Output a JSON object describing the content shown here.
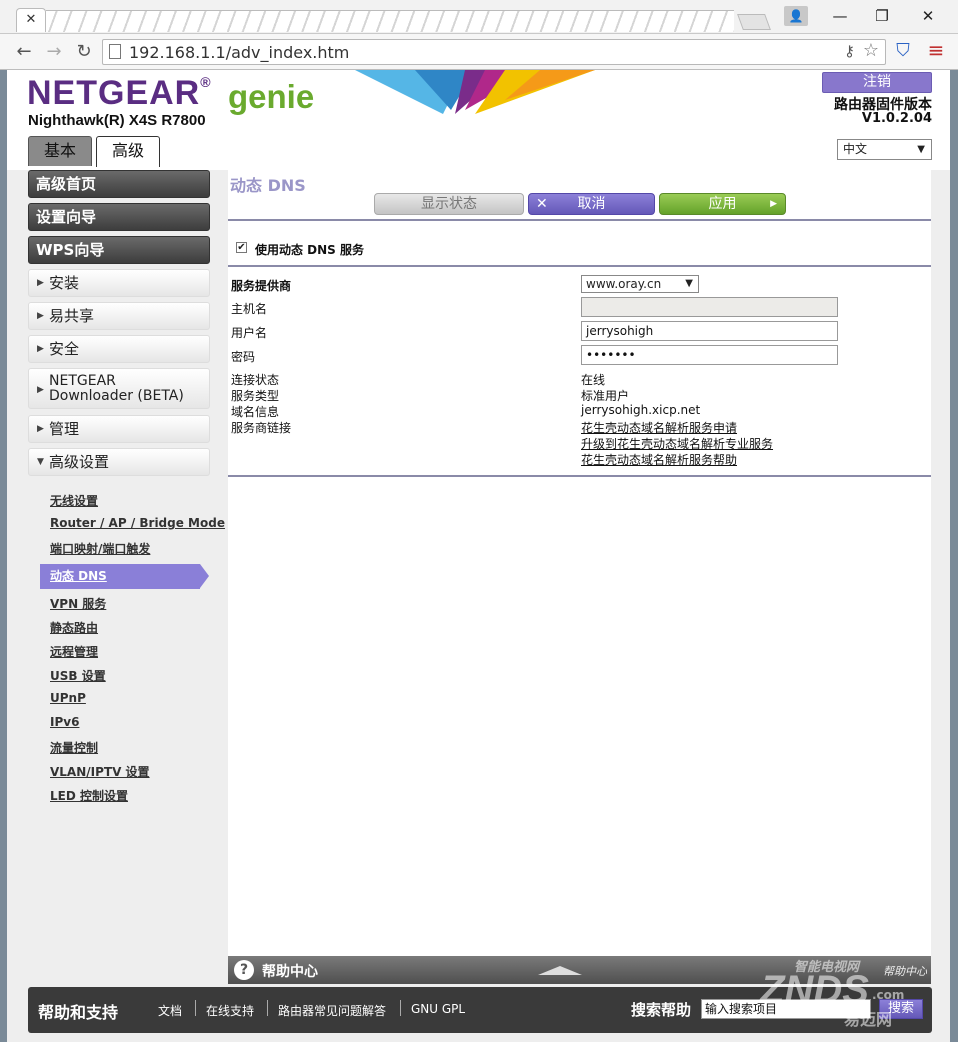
{
  "browser": {
    "url": "192.168.1.1/adv_index.htm",
    "close_tab_label": "✕",
    "window_controls": [
      "—",
      "❐",
      "✕"
    ],
    "nav_icons": [
      "back-icon",
      "forward-icon",
      "reload-icon"
    ]
  },
  "header": {
    "brand": "NETGEAR",
    "brand_mark": "®",
    "product": "genie",
    "model": "Nighthawk(R) X4S R7800",
    "logout": "注销",
    "firmware_label": "路由器固件版本",
    "firmware_version": "V1.0.2.04",
    "tabs": [
      "基本",
      "高级"
    ],
    "language": "中文",
    "colors": {
      "brand": "#5a2d82",
      "genie": "#6aaa2e",
      "accent": "#8a7fd8"
    }
  },
  "sidebar": {
    "dark_items": [
      "高级首页",
      "设置向导",
      "WPS向导"
    ],
    "items": [
      {
        "label": "安装",
        "state": "collapsed"
      },
      {
        "label": "易共享",
        "state": "collapsed"
      },
      {
        "label": "安全",
        "state": "collapsed"
      },
      {
        "label": "NETGEAR",
        "label2": "Downloader (BETA)",
        "state": "collapsed"
      },
      {
        "label": "管理",
        "state": "collapsed"
      },
      {
        "label": "高级设置",
        "state": "expanded"
      }
    ],
    "sub_items": [
      "无线设置",
      "Router / AP / Bridge Mode",
      "端口映射/端口触发",
      "动态 DNS",
      "VPN 服务",
      "静态路由",
      "远程管理",
      "USB 设置",
      "UPnP",
      "IPv6",
      "流量控制",
      "VLAN/IPTV 设置",
      "LED 控制设置"
    ],
    "active_sub": "动态 DNS"
  },
  "main": {
    "title": "动态 DNS",
    "buttons": {
      "status": "显示状态",
      "cancel": "取消",
      "apply": "应用"
    },
    "use_ddns": {
      "label": "使用动态 DNS 服务",
      "checked": true,
      "check_glyph": "✔"
    },
    "form": {
      "provider_label": "服务提供商",
      "provider_value": "www.oray.cn",
      "host_label": "主机名",
      "host_value": "",
      "user_label": "用户名",
      "user_value": "jerrysohigh",
      "password_label": "密码",
      "password_value": "•••••••"
    },
    "info": {
      "status_label": "连接状态",
      "status_value": "在线",
      "type_label": "服务类型",
      "type_value": "标准用户",
      "domain_label": "域名信息",
      "domain_value": "jerrysohigh.xicp.net",
      "links_label": "服务商链接",
      "links": [
        "花生壳动态域名解析服务申请",
        "升级到花生壳动态域名解析专业服务",
        "花生壳动态域名解析服务帮助"
      ]
    }
  },
  "help": {
    "label": "帮助中心",
    "right_text": "帮助中心"
  },
  "footer": {
    "title": "帮助和支持",
    "links": [
      "文档",
      "在线支持",
      "路由器常见问题解答",
      "GNU GPL"
    ],
    "search_label": "搜索帮助",
    "search_placeholder": "输入搜索项目",
    "search_button": "搜索"
  },
  "watermark": {
    "top": "智能电视网",
    "big": "ZNDS",
    "com": ".com",
    "sub": "易迈网"
  }
}
